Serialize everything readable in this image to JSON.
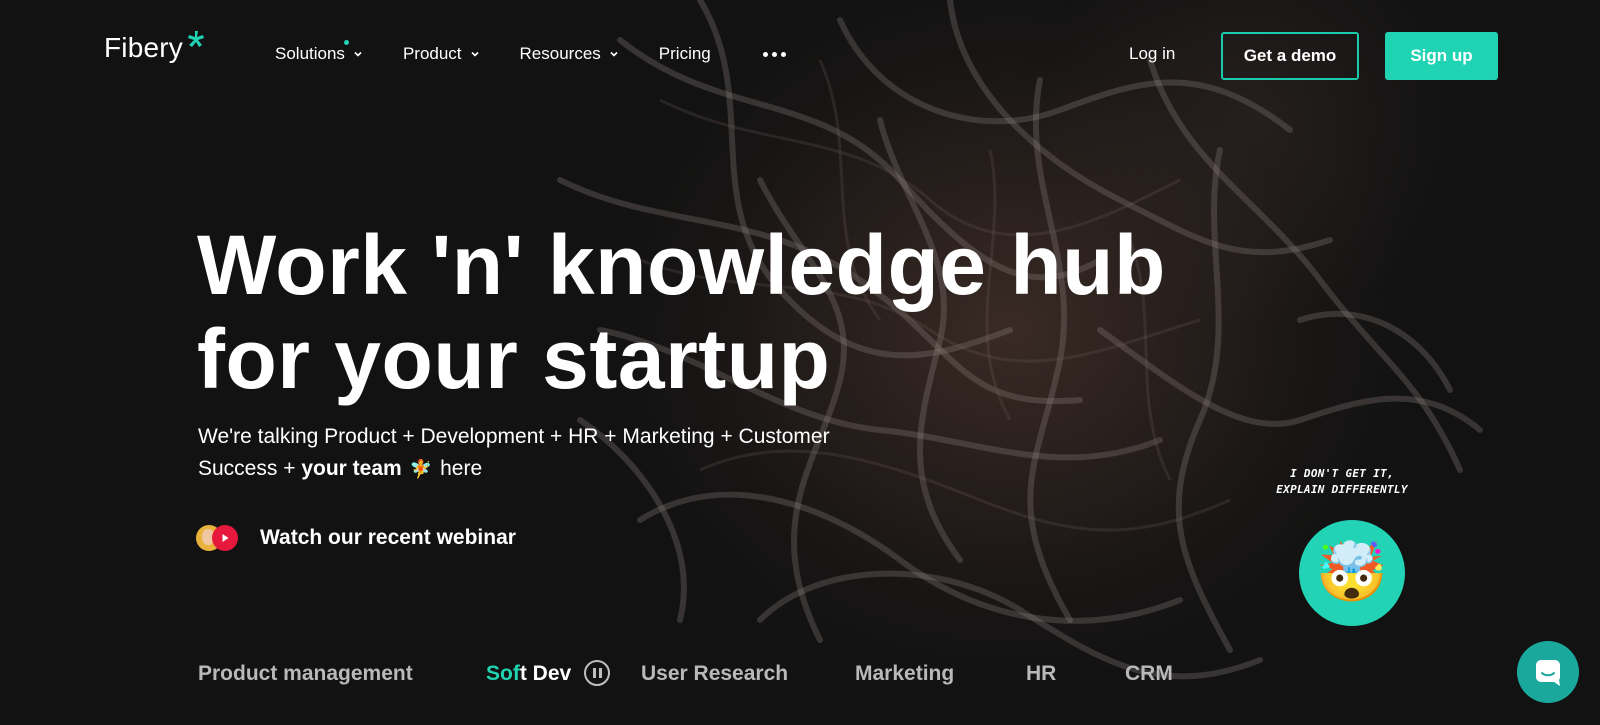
{
  "brand": {
    "name": "Fibery",
    "accent": "#1fd3b3"
  },
  "nav": {
    "items": [
      {
        "label": "Solutions",
        "has_dropdown": true,
        "has_dot": true
      },
      {
        "label": "Product",
        "has_dropdown": true
      },
      {
        "label": "Resources",
        "has_dropdown": true
      },
      {
        "label": "Pricing",
        "has_dropdown": false
      }
    ],
    "more_icon": "more-dots-icon",
    "login": "Log in",
    "demo": "Get a demo",
    "signup": "Sign up"
  },
  "hero": {
    "title_line1": "Work 'n' knowledge hub",
    "title_line2": "for your startup",
    "sub_line1": "We're talking Product + Development + HR + Marketing + Customer",
    "sub_line2_prefix": "Success + ",
    "sub_line2_bold": "your team",
    "sub_line2_emoji": "🧚",
    "sub_line2_suffix": "here",
    "webinar_label": "Watch our recent webinar"
  },
  "explain": {
    "line1": "I DON'T GET IT,",
    "line2": "EXPLAIN DIFFERENTLY",
    "emoji": "🤯"
  },
  "tabs": {
    "items": [
      {
        "label": "Product management"
      },
      {
        "label_highlight": "Sof",
        "label_rest": "t Dev",
        "active": true
      },
      {
        "label": "User Research"
      },
      {
        "label": "Marketing"
      },
      {
        "label": "HR"
      },
      {
        "label": "CRM"
      }
    ],
    "pause_icon": "pause-icon"
  },
  "chat": {
    "icon": "chat-icon",
    "color": "#1aa89c"
  }
}
